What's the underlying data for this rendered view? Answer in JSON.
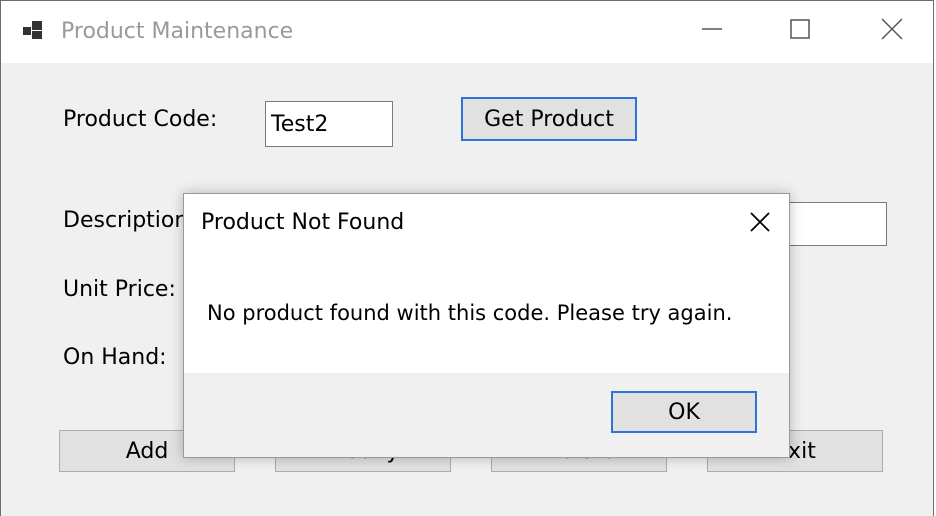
{
  "window": {
    "title": "Product Maintenance",
    "icons": {
      "app": "app-icon",
      "minimize": "minimize-icon",
      "maximize": "maximize-icon",
      "close": "close-icon"
    }
  },
  "form": {
    "product_code_label": "Product Code:",
    "product_code_value": "Test2",
    "get_product_label": "Get Product",
    "description_label": "Description:",
    "unit_price_label": "Unit Price:",
    "on_hand_label": "On Hand:",
    "add_label": "Add",
    "modify_label": "Modify",
    "delete_label": "Delete",
    "exit_label": "Exit"
  },
  "dialog": {
    "title": "Product Not Found",
    "message": "No product found with this code. Please try again.",
    "ok_label": "OK"
  },
  "colors": {
    "focus_border": "#2e74d6",
    "window_bg": "#f0f0f0",
    "button_bg": "#e1e1e1"
  }
}
